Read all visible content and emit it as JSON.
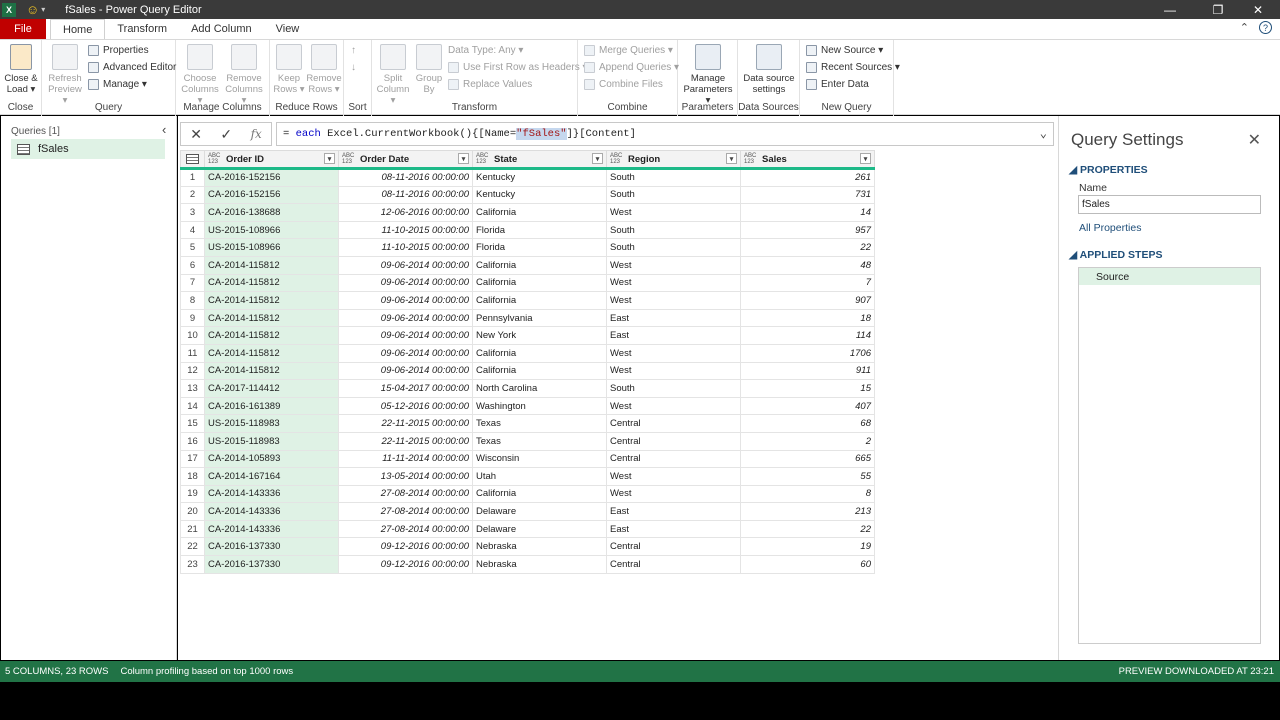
{
  "window": {
    "title": "fSales - Power Query Editor"
  },
  "tabs": [
    "File",
    "Home",
    "Transform",
    "Add Column",
    "View"
  ],
  "ribbon": {
    "close_group": {
      "label": "Close",
      "close_load": "Close &",
      "close_load2": "Load ▾"
    },
    "query_group": {
      "label": "Query",
      "refresh": "Refresh",
      "refresh2": "Preview ▾",
      "properties": "Properties",
      "advanced_editor": "Advanced Editor",
      "manage": "Manage ▾"
    },
    "manage_columns": {
      "label": "Manage Columns",
      "choose": "Choose",
      "choose2": "Columns ▾",
      "remove": "Remove",
      "remove2": "Columns ▾"
    },
    "reduce_rows": {
      "label": "Reduce Rows",
      "keep": "Keep",
      "keep2": "Rows ▾",
      "remove": "Remove",
      "remove2": "Rows ▾"
    },
    "sort": {
      "label": "Sort"
    },
    "transform": {
      "label": "Transform",
      "split": "Split",
      "split2": "Column ▾",
      "group": "Group",
      "group2": "By",
      "data_type": "Data Type: Any ▾",
      "first_row": "Use First Row as Headers ▾",
      "replace": "Replace Values"
    },
    "combine": {
      "label": "Combine",
      "merge": "Merge Queries ▾",
      "append": "Append Queries ▾",
      "combine_files": "Combine Files"
    },
    "parameters": {
      "label": "Parameters",
      "manage": "Manage",
      "manage2": "Parameters ▾"
    },
    "data_sources": {
      "label": "Data Sources",
      "settings": "Data source",
      "settings2": "settings"
    },
    "new_query": {
      "label": "New Query",
      "new_source": "New Source ▾",
      "recent": "Recent Sources ▾",
      "enter": "Enter Data"
    }
  },
  "queries": {
    "header": "Queries [1]",
    "items": [
      "fSales"
    ]
  },
  "formula": {
    "prefix": "= ",
    "kw": "each",
    "before": " Excel.CurrentWorkbook(){[Name=",
    "selected": "\"fSales\"",
    "after": "]}[Content]"
  },
  "grid": {
    "type_badge_top": "ABC",
    "type_badge_bottom": "123",
    "columns": [
      "Order ID",
      "Order Date",
      "State",
      "Region",
      "Sales"
    ],
    "rows": [
      [
        "CA-2016-152156",
        "08-11-2016 00:00:00",
        "Kentucky",
        "South",
        "261"
      ],
      [
        "CA-2016-152156",
        "08-11-2016 00:00:00",
        "Kentucky",
        "South",
        "731"
      ],
      [
        "CA-2016-138688",
        "12-06-2016 00:00:00",
        "California",
        "West",
        "14"
      ],
      [
        "US-2015-108966",
        "11-10-2015 00:00:00",
        "Florida",
        "South",
        "957"
      ],
      [
        "US-2015-108966",
        "11-10-2015 00:00:00",
        "Florida",
        "South",
        "22"
      ],
      [
        "CA-2014-115812",
        "09-06-2014 00:00:00",
        "California",
        "West",
        "48"
      ],
      [
        "CA-2014-115812",
        "09-06-2014 00:00:00",
        "California",
        "West",
        "7"
      ],
      [
        "CA-2014-115812",
        "09-06-2014 00:00:00",
        "California",
        "West",
        "907"
      ],
      [
        "CA-2014-115812",
        "09-06-2014 00:00:00",
        "Pennsylvania",
        "East",
        "18"
      ],
      [
        "CA-2014-115812",
        "09-06-2014 00:00:00",
        "New York",
        "East",
        "114"
      ],
      [
        "CA-2014-115812",
        "09-06-2014 00:00:00",
        "California",
        "West",
        "1706"
      ],
      [
        "CA-2014-115812",
        "09-06-2014 00:00:00",
        "California",
        "West",
        "911"
      ],
      [
        "CA-2017-114412",
        "15-04-2017 00:00:00",
        "North Carolina",
        "South",
        "15"
      ],
      [
        "CA-2016-161389",
        "05-12-2016 00:00:00",
        "Washington",
        "West",
        "407"
      ],
      [
        "US-2015-118983",
        "22-11-2015 00:00:00",
        "Texas",
        "Central",
        "68"
      ],
      [
        "US-2015-118983",
        "22-11-2015 00:00:00",
        "Texas",
        "Central",
        "2"
      ],
      [
        "CA-2014-105893",
        "11-11-2014 00:00:00",
        "Wisconsin",
        "Central",
        "665"
      ],
      [
        "CA-2014-167164",
        "13-05-2014 00:00:00",
        "Utah",
        "West",
        "55"
      ],
      [
        "CA-2014-143336",
        "27-08-2014 00:00:00",
        "California",
        "West",
        "8"
      ],
      [
        "CA-2014-143336",
        "27-08-2014 00:00:00",
        "Delaware",
        "East",
        "213"
      ],
      [
        "CA-2014-143336",
        "27-08-2014 00:00:00",
        "Delaware",
        "East",
        "22"
      ],
      [
        "CA-2016-137330",
        "09-12-2016 00:00:00",
        "Nebraska",
        "Central",
        "19"
      ],
      [
        "CA-2016-137330",
        "09-12-2016 00:00:00",
        "Nebraska",
        "Central",
        "60"
      ]
    ]
  },
  "settings": {
    "title": "Query Settings",
    "properties_header": "PROPERTIES",
    "name_label": "Name",
    "name_value": "fSales",
    "all_properties": "All Properties",
    "steps_header": "APPLIED STEPS",
    "steps": [
      "Source"
    ]
  },
  "status": {
    "left1": "5 COLUMNS, 23 ROWS",
    "left2": "Column profiling based on top 1000 rows",
    "right": "PREVIEW DOWNLOADED AT 23:21"
  },
  "colors": {
    "accent_green": "#217346",
    "selected_col": "#dff2e5",
    "file_tab": "#c00000",
    "header_underline": "#1db988"
  }
}
